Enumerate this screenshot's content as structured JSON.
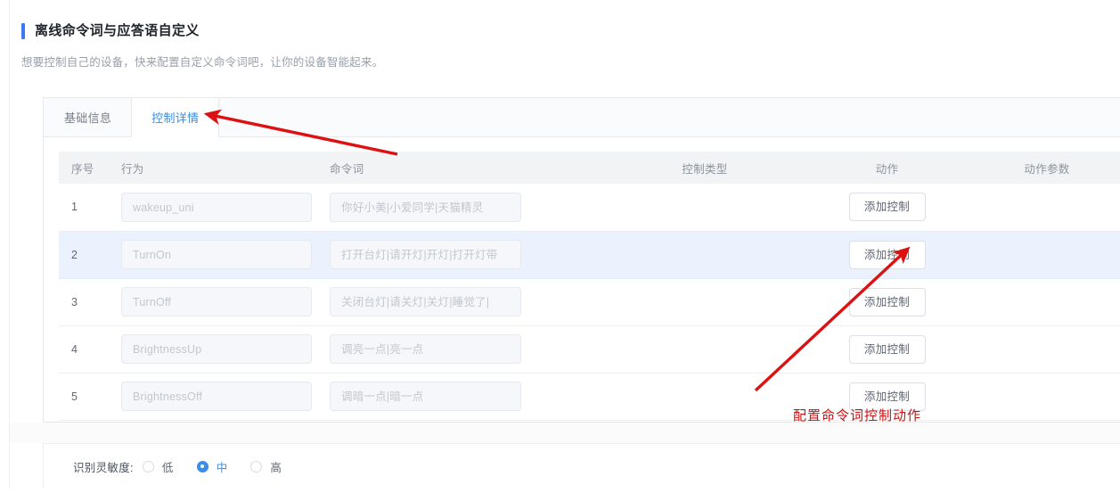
{
  "page": {
    "title": "离线命令词与应答语自定义",
    "subtitle": "想要控制自己的设备，快来配置自定义命令词吧，让你的设备智能起来。"
  },
  "tabs": [
    {
      "label": "基础信息",
      "active": false
    },
    {
      "label": "控制详情",
      "active": true
    }
  ],
  "table": {
    "columns": {
      "index": "序号",
      "behavior": "行为",
      "command": "命令词",
      "control_type": "控制类型",
      "action": "动作",
      "action_param": "动作参数"
    },
    "rows": [
      {
        "index": "1",
        "behavior": "wakeup_uni",
        "command": "你好小美|小爱同学|天猫精灵",
        "control_type": "",
        "action_button": "添加控制",
        "action_param": "",
        "highlighted": false
      },
      {
        "index": "2",
        "behavior": "TurnOn",
        "command": "打开台灯|请开灯|开灯|打开灯带",
        "control_type": "",
        "action_button": "添加控制",
        "action_param": "",
        "highlighted": true
      },
      {
        "index": "3",
        "behavior": "TurnOff",
        "command": "关闭台灯|请关灯|关灯|睡觉了|",
        "control_type": "",
        "action_button": "添加控制",
        "action_param": "",
        "highlighted": false
      },
      {
        "index": "4",
        "behavior": "BrightnessUp",
        "command": "调亮一点|亮一点",
        "control_type": "",
        "action_button": "添加控制",
        "action_param": "",
        "highlighted": false
      },
      {
        "index": "5",
        "behavior": "BrightnessOff",
        "command": "调暗一点|暗一点",
        "control_type": "",
        "action_button": "添加控制",
        "action_param": "",
        "highlighted": false
      }
    ]
  },
  "sensitivity": {
    "label": "识别灵敏度:",
    "options": [
      {
        "label": "低",
        "selected": false
      },
      {
        "label": "中",
        "selected": true
      },
      {
        "label": "高",
        "selected": false
      }
    ]
  },
  "annotations": {
    "color": "#cc1111",
    "caption": "配置命令词控制动作"
  }
}
